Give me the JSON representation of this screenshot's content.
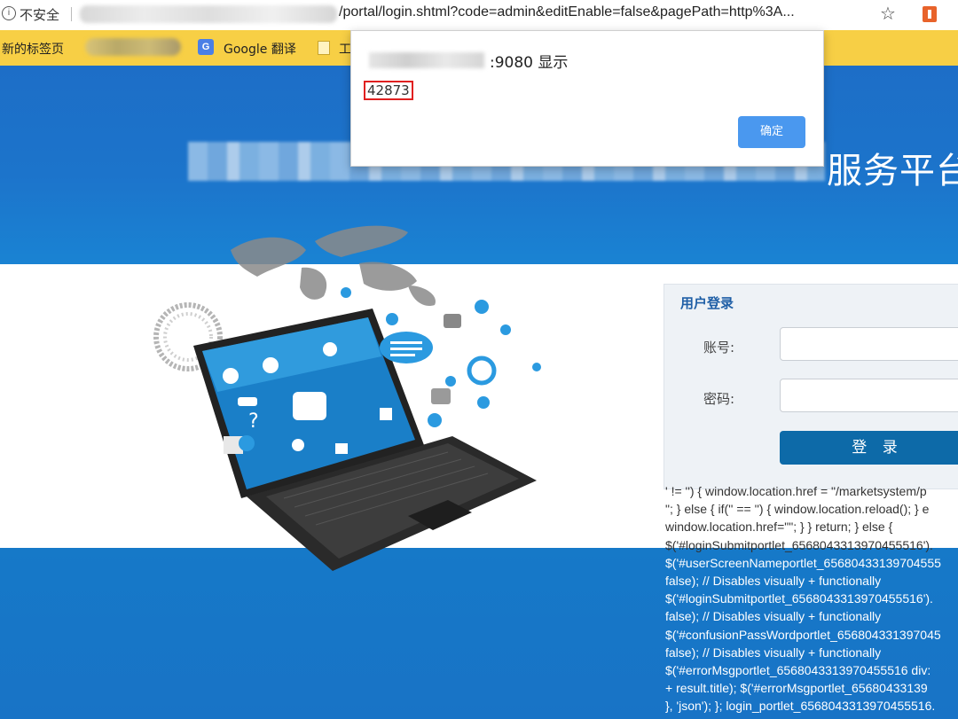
{
  "browser": {
    "security_label": "不安全",
    "url_visible": "/portal/login.shtml?code=admin&editEnable=false&pagePath=http%3A..."
  },
  "bookmarks": {
    "new_tab": "新的标签页",
    "google_translate": "Google 翻译",
    "partial_folder": "工"
  },
  "page": {
    "title_visible_tail": "服务平台"
  },
  "login": {
    "title": "用户登录",
    "account_label": "账号:",
    "password_label": "密码:",
    "submit_label": "登 录"
  },
  "code_text": [
    "' != '') { window.location.href = \"/marketsystem/p",
    "\"; } else { if('' == '') { window.location.reload(); } e",
    "window.location.href=\"\"; } } return; } else {",
    "$('#loginSubmitportlet_6568043313970455516').",
    "$('#userScreenNameportlet_65680433139704555",
    "false); // Disables visually + functionally",
    "$('#loginSubmitportlet_6568043313970455516').",
    "false); // Disables visually + functionally",
    "$('#confusionPassWordportlet_656804331397045",
    "false); // Disables visually + functionally",
    "$('#errorMsgportlet_6568043313970455516 div:",
    "+ result.title); $('#errorMsgportlet_65680433139",
    "}, 'json'); }; login_portlet_6568043313970455516."
  ],
  "dialog": {
    "host_suffix": ":9080 显示",
    "message": "42873",
    "ok_label": "确定"
  },
  "colors": {
    "brand_blue": "#1d6ec7",
    "login_button": "#0d6aa8",
    "dialog_button": "#4a98ef",
    "highlight_border": "#e02020",
    "bookmark_bar": "#f7cf45"
  },
  "icons": [
    "info-icon",
    "star-icon",
    "extension-icon",
    "google-translate-icon",
    "folder-icon"
  ]
}
